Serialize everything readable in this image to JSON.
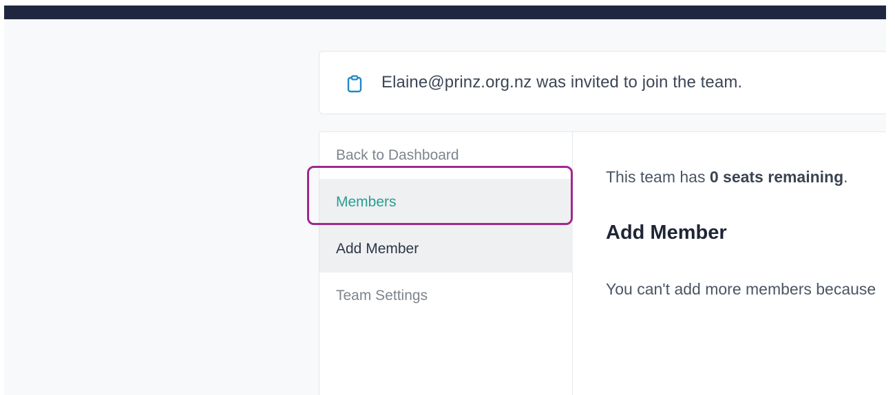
{
  "notification": {
    "icon": "clipboard-icon",
    "message": "Elaine@prinz.org.nz was invited to join the team."
  },
  "sidebar": {
    "items": [
      {
        "label": "Back to Dashboard",
        "state": "normal"
      },
      {
        "label": "Members",
        "state": "active"
      },
      {
        "label": "Add Member",
        "state": "hover"
      },
      {
        "label": "Team Settings",
        "state": "normal"
      }
    ]
  },
  "content": {
    "seats_prefix": "This team has ",
    "seats_bold": "0 seats remaining",
    "seats_suffix": ".",
    "add_member_heading": "Add Member",
    "cannot_add_text": "You can't add more members because"
  },
  "colors": {
    "topbar": "#1f2740",
    "accent_teal": "#2a9d8f",
    "highlight_outline": "#a0278f"
  }
}
